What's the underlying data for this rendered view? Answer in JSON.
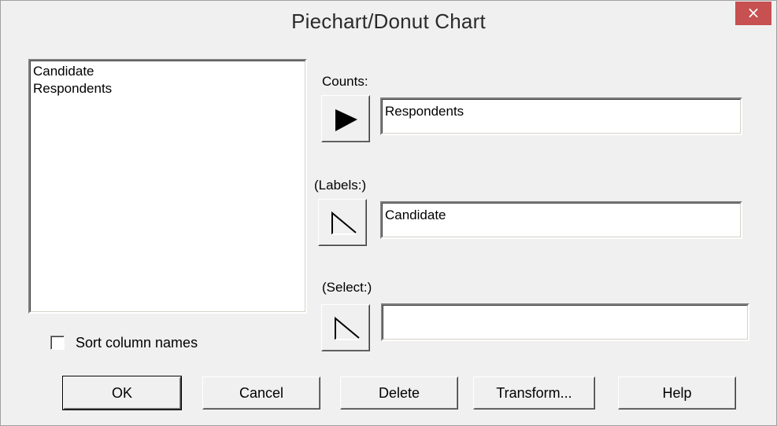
{
  "window": {
    "title": "Piechart/Donut Chart",
    "close_glyph": "×"
  },
  "column_list": {
    "items": [
      "Candidate",
      "Respondents"
    ]
  },
  "sort_checkbox": {
    "label": "Sort column names",
    "checked": false
  },
  "fields": {
    "counts": {
      "label": "Counts:",
      "value": "Respondents",
      "arrow_state": "filled"
    },
    "labels": {
      "label": "(Labels:)",
      "value": "Candidate",
      "arrow_state": "outline"
    },
    "select": {
      "label": "(Select:)",
      "value": "",
      "arrow_state": "outline"
    }
  },
  "buttons": {
    "ok": "OK",
    "cancel": "Cancel",
    "delete": "Delete",
    "transform": "Transform...",
    "help": "Help"
  },
  "colors": {
    "close_button": "#c75050",
    "dialog_bg": "#f0f0f0"
  }
}
